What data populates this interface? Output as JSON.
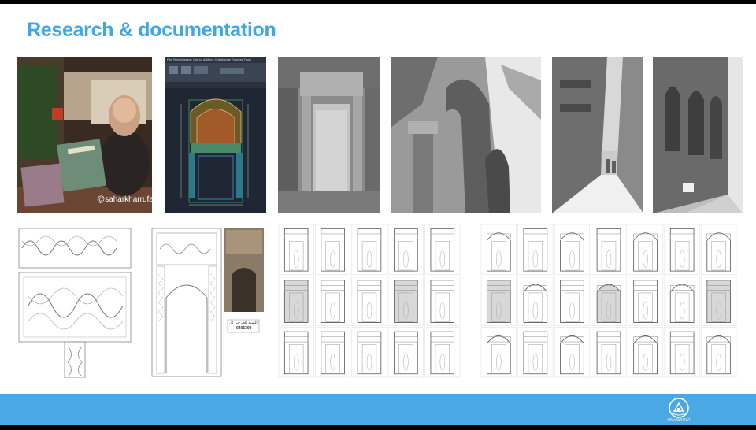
{
  "slide": {
    "title": "Research & documentation",
    "photo_caption": "@saharkharrufa",
    "cad_menu": [
      "File",
      "View",
      "Manage",
      "Output",
      "Add-ins",
      "Collaborate",
      "Express Tools"
    ],
    "label_arabic": "السيد الجرجي لل",
    "label_code": "0405309"
  },
  "footer": {
    "logo_text": "UN-HABITAT"
  },
  "colors": {
    "title": "#3ea7e6",
    "rule": "#8fc9ee",
    "footer": "#4aa8e4",
    "cad_bg": "#1e2733"
  },
  "icons": [
    "un-habitat-logo"
  ]
}
